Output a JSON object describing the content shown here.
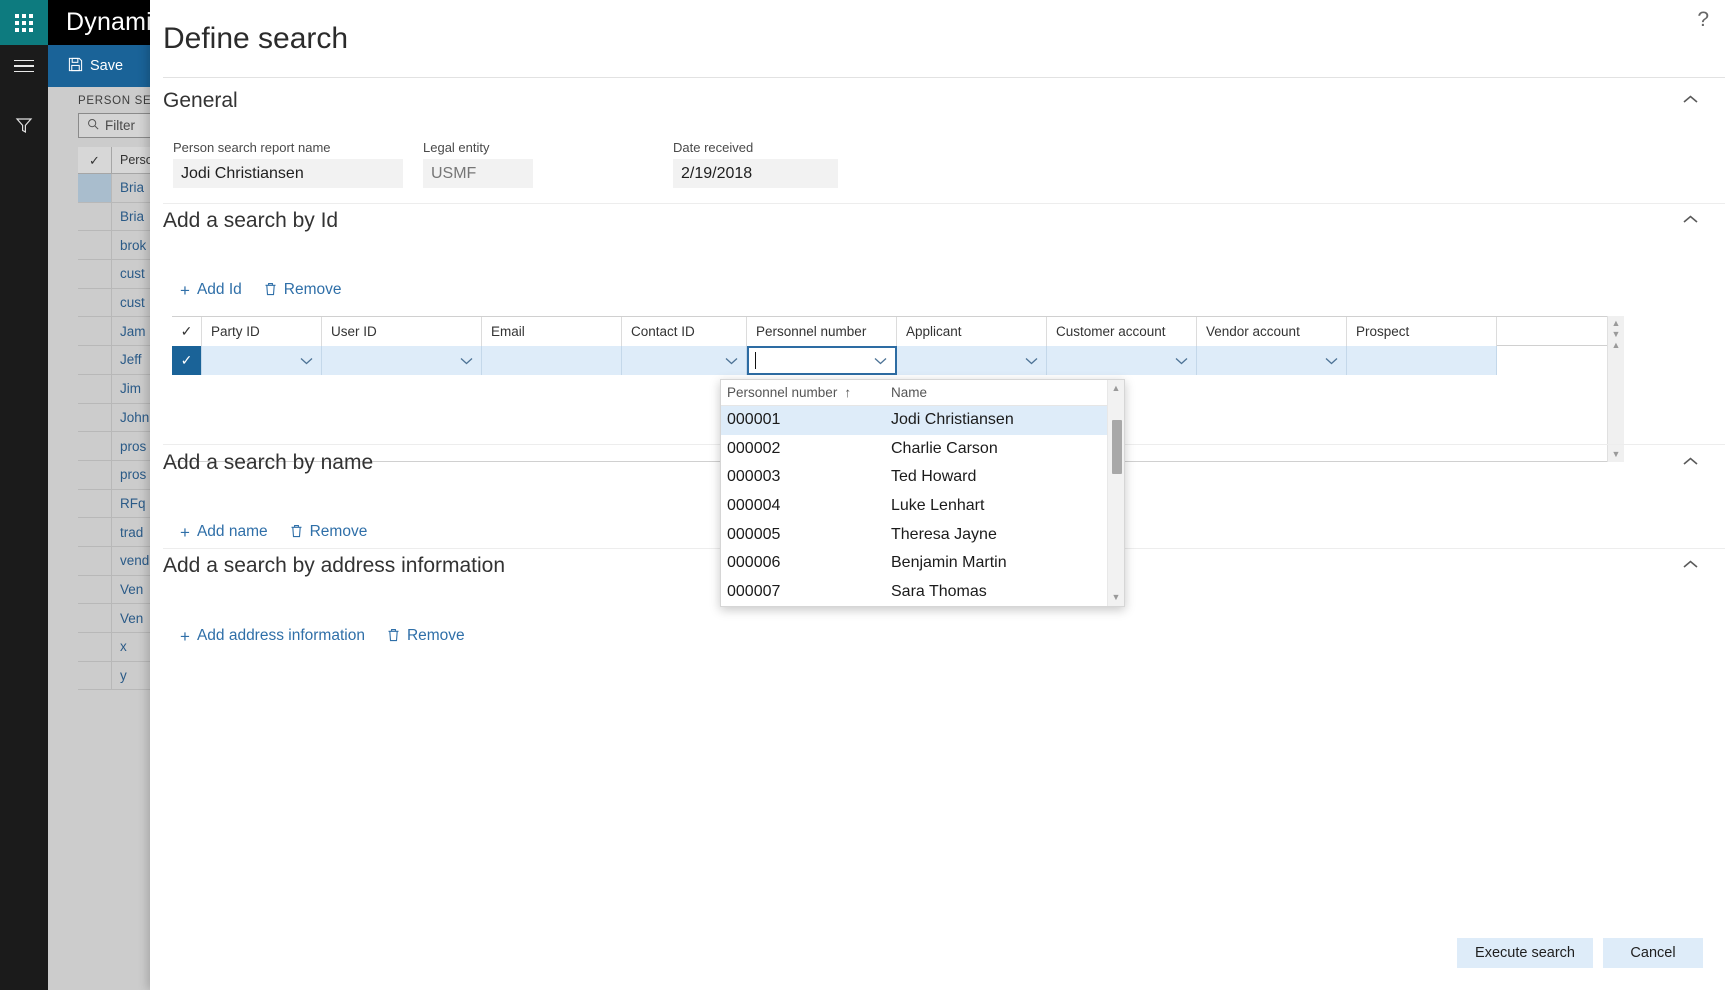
{
  "app": {
    "title": "Dynamics",
    "waffle_icon": "waffle-grid-icon",
    "hamburger_icon": "hamburger-icon",
    "filter_icon": "funnel-filter-icon",
    "actionbar": {
      "save_label": "Save",
      "save_icon": "save-disk-icon",
      "new_icon": "plus-icon"
    },
    "list": {
      "caption": "PERSON SE",
      "filter_placeholder": "Filter",
      "search_icon": "search-icon",
      "columns": [
        "Perso"
      ],
      "check_icon": "checkmark-icon",
      "rows": [
        {
          "name": "Bria",
          "selected": true
        },
        {
          "name": "Bria",
          "selected": false
        },
        {
          "name": "brok",
          "selected": false
        },
        {
          "name": "cust",
          "selected": false
        },
        {
          "name": "cust",
          "selected": false
        },
        {
          "name": "Jam",
          "selected": false
        },
        {
          "name": "Jeff",
          "selected": false
        },
        {
          "name": "Jim ",
          "selected": false
        },
        {
          "name": "John",
          "selected": false
        },
        {
          "name": "pros",
          "selected": false
        },
        {
          "name": "pros",
          "selected": false
        },
        {
          "name": "RFq",
          "selected": false
        },
        {
          "name": "trad",
          "selected": false
        },
        {
          "name": "vend",
          "selected": false
        },
        {
          "name": "Ven",
          "selected": false
        },
        {
          "name": "Ven",
          "selected": false
        },
        {
          "name": "x",
          "selected": false
        },
        {
          "name": "y",
          "selected": false
        }
      ]
    }
  },
  "dialog": {
    "title": "Define search",
    "help_icon": "question-mark-icon",
    "collapse_icon": "chevron-up-icon",
    "sections": {
      "general": {
        "title": "General",
        "fields": {
          "report_name": {
            "label": "Person search report name",
            "value": "Jodi Christiansen"
          },
          "legal_entity": {
            "label": "Legal entity",
            "value": "USMF"
          },
          "date_received": {
            "label": "Date received",
            "value": "2/19/2018"
          }
        }
      },
      "search_by_id": {
        "title": "Add a search by Id",
        "toolbar": {
          "add_label": "Add Id",
          "add_icon": "plus-icon",
          "remove_label": "Remove",
          "remove_icon": "trash-icon"
        },
        "grid": {
          "check_icon": "checkmark-icon",
          "columns": [
            {
              "label": "Party ID",
              "has_dropdown": true
            },
            {
              "label": "User ID",
              "has_dropdown": true
            },
            {
              "label": "Email",
              "has_dropdown": false
            },
            {
              "label": "Contact ID",
              "has_dropdown": true
            },
            {
              "label": "Personnel number",
              "has_dropdown": true
            },
            {
              "label": "Applicant",
              "has_dropdown": true
            },
            {
              "label": "Customer account",
              "has_dropdown": true
            },
            {
              "label": "Vendor account",
              "has_dropdown": true
            },
            {
              "label": "Prospect",
              "has_dropdown": false
            }
          ],
          "row": {
            "selected": true,
            "values": [
              "",
              "",
              "",
              "",
              "",
              "",
              "",
              "",
              ""
            ],
            "active_column": "Personnel number",
            "active_value": ""
          },
          "scroll_up_icon": "chevron-up-icon",
          "scroll_down_icon": "chevron-down-icon"
        },
        "lookup": {
          "columns": [
            {
              "label": "Personnel number",
              "sort_icon": "sort-ascending-arrow"
            },
            {
              "label": "Name",
              "sort_icon": ""
            }
          ],
          "rows": [
            {
              "number": "000001",
              "name": "Jodi Christiansen",
              "selected": true
            },
            {
              "number": "000002",
              "name": "Charlie Carson",
              "selected": false
            },
            {
              "number": "000003",
              "name": "Ted Howard",
              "selected": false
            },
            {
              "number": "000004",
              "name": "Luke Lenhart",
              "selected": false
            },
            {
              "number": "000005",
              "name": "Theresa Jayne",
              "selected": false
            },
            {
              "number": "000006",
              "name": "Benjamin Martin",
              "selected": false
            },
            {
              "number": "000007",
              "name": "Sara Thomas",
              "selected": false
            }
          ],
          "scroll_up_icon": "chevron-up-icon",
          "scroll_down_icon": "chevron-down-icon"
        }
      },
      "search_by_name": {
        "title": "Add a search by name",
        "toolbar": {
          "add_label": "Add name",
          "add_icon": "plus-icon",
          "remove_label": "Remove",
          "remove_icon": "trash-icon"
        }
      },
      "search_by_address": {
        "title": "Add a search by address information",
        "toolbar": {
          "add_label": "Add address information",
          "add_icon": "plus-icon",
          "remove_label": "Remove",
          "remove_icon": "trash-icon"
        }
      }
    },
    "footer": {
      "execute_label": "Execute search",
      "cancel_label": "Cancel"
    }
  },
  "colors": {
    "brand_teal": "#0d7b7f",
    "action_blue": "#1a6398",
    "link_blue": "#2f6fa8",
    "row_highlight": "#deecf9",
    "button_bg": "#deecf9"
  }
}
